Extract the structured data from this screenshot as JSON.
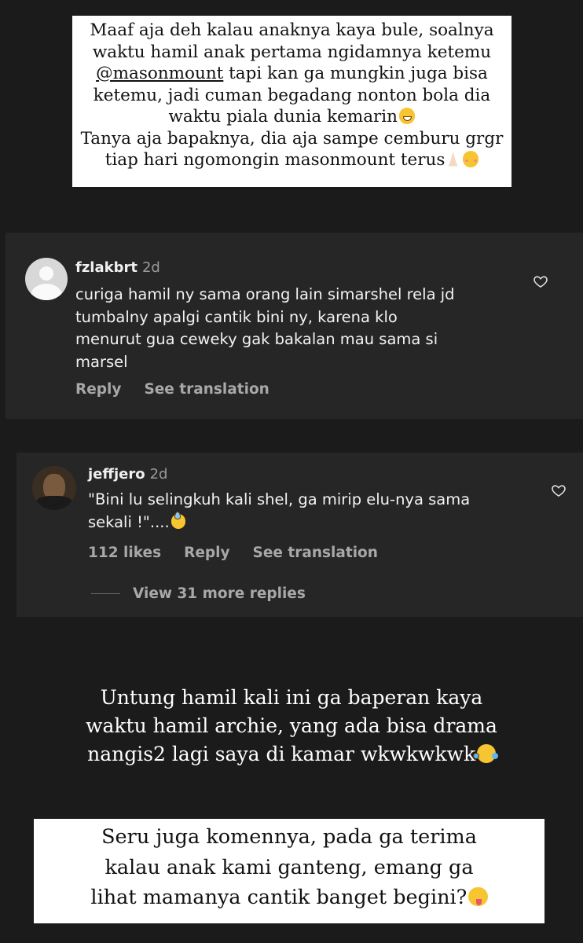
{
  "caption_top": {
    "line1": "Maaf aja deh kalau anaknya kaya bule, soalnya",
    "line2": "waktu hamil anak pertama ngidamnya ketemu",
    "line3_mention": "@masonmount",
    "line3_rest": " tapi kan ga mungkin juga bisa",
    "line4": "ketemu, jadi cuman begadang nonton bola dia",
    "line5": "waktu piala dunia kemarin",
    "line6": "Tanya aja bapaknya, dia aja sampe cemburu grgr",
    "line7": "tiap hari ngomongin masonmount terus"
  },
  "comments": [
    {
      "username": "fzlakbrt",
      "time": "2d",
      "lines": [
        "curiga hamil ny sama orang lain simarshel rela jd",
        "tumbalny apalgi cantik bini ny, karena klo",
        "menurut gua ceweky gak bakalan mau sama si",
        "marsel"
      ],
      "reply_label": "Reply",
      "translate_label": "See translation"
    },
    {
      "username": "jeffjero",
      "time": "2d",
      "lines": [
        "\"Bini lu selingkuh kali shel, ga mirip elu-nya sama",
        "sekali !\"...."
      ],
      "likes_label": "112 likes",
      "reply_label": "Reply",
      "translate_label": "See translation",
      "view_replies_label": "View 31 more replies"
    }
  ],
  "caption_mid": {
    "line1": "Untung hamil kali ini ga baperan kaya",
    "line2": "waktu hamil archie, yang ada bisa drama",
    "line3": "nangis2 lagi saya di kamar wkwkwkwk"
  },
  "caption_bottom": {
    "line1": "Seru juga komennya, pada ga terima",
    "line2": "kalau anak kami ganteng, emang ga",
    "line3": "lihat mamanya cantik banget begini?"
  },
  "colors": {
    "background": "#1b1b1b",
    "comment_panel": "#262626",
    "caption_box": "#ffffff"
  },
  "icons": [
    "heart-icon",
    "grinning-face-emoji",
    "folded-hands-emoji",
    "smiling-face-emoji",
    "sweat-smile-emoji",
    "tears-of-joy-emoji",
    "tongue-face-emoji"
  ]
}
